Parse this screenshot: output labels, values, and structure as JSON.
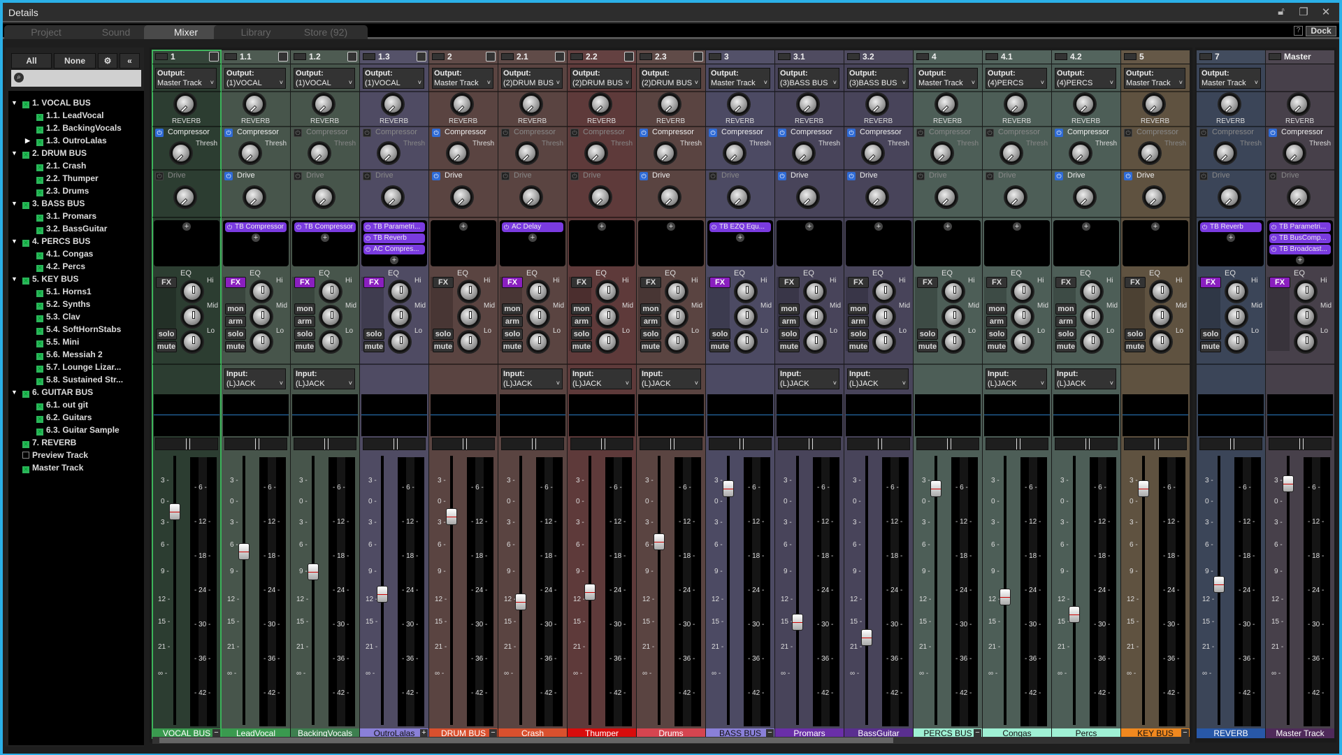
{
  "window": {
    "title": "Details"
  },
  "tabs": [
    {
      "label": "Project",
      "active": false
    },
    {
      "label": "Sound",
      "active": false
    },
    {
      "label": "Mixer",
      "active": true
    },
    {
      "label": "Library",
      "active": false
    },
    {
      "label": "Store (92)",
      "active": false
    }
  ],
  "toolbar": {
    "help_label": "?",
    "dock_label": "Dock"
  },
  "sidebar": {
    "all_label": "All",
    "none_label": "None",
    "search_placeholder": "",
    "tree": [
      {
        "label": "1. VOCAL BUS",
        "level": 0,
        "expanded": true,
        "checked": true
      },
      {
        "label": "1.1. LeadVocal",
        "level": 1,
        "checked": true
      },
      {
        "label": "1.2. BackingVocals",
        "level": 1,
        "checked": true
      },
      {
        "label": "1.3. OutroLalas",
        "level": 1,
        "checked": true,
        "collapsed": true
      },
      {
        "label": "2. DRUM BUS",
        "level": 0,
        "expanded": true,
        "checked": true
      },
      {
        "label": "2.1. Crash",
        "level": 1,
        "checked": true
      },
      {
        "label": "2.2. Thumper",
        "level": 1,
        "checked": true
      },
      {
        "label": "2.3. Drums",
        "level": 1,
        "checked": true
      },
      {
        "label": "3. BASS BUS",
        "level": 0,
        "expanded": true,
        "checked": true
      },
      {
        "label": "3.1. Promars",
        "level": 1,
        "checked": true
      },
      {
        "label": "3.2. BassGuitar",
        "level": 1,
        "checked": true
      },
      {
        "label": "4. PERCS BUS",
        "level": 0,
        "expanded": true,
        "checked": true
      },
      {
        "label": "4.1. Congas",
        "level": 1,
        "checked": true
      },
      {
        "label": "4.2. Percs",
        "level": 1,
        "checked": true
      },
      {
        "label": "5. KEY BUS",
        "level": 0,
        "expanded": true,
        "checked": true
      },
      {
        "label": "5.1. Horns1",
        "level": 1,
        "checked": true
      },
      {
        "label": "5.2. Synths",
        "level": 1,
        "checked": true
      },
      {
        "label": "5.3. Clav",
        "level": 1,
        "checked": true
      },
      {
        "label": "5.4. SoftHornStabs",
        "level": 1,
        "checked": true
      },
      {
        "label": "5.5. Mini",
        "level": 1,
        "checked": true
      },
      {
        "label": "5.6. Messiah 2",
        "level": 1,
        "checked": true
      },
      {
        "label": "5.7. Lounge Lizar...",
        "level": 1,
        "checked": true
      },
      {
        "label": "5.8. Sustained Str...",
        "level": 1,
        "checked": true
      },
      {
        "label": "6. GUITAR BUS",
        "level": 0,
        "expanded": true,
        "checked": true
      },
      {
        "label": "6.1. out git",
        "level": 1,
        "checked": true
      },
      {
        "label": "6.2. Guitars",
        "level": 1,
        "checked": true
      },
      {
        "label": "6.3. Guitar Sample",
        "level": 1,
        "checked": true
      },
      {
        "label": "7. REVERB",
        "level": 0,
        "checked": true
      },
      {
        "label": "Preview Track",
        "level": 0,
        "checked": false
      },
      {
        "label": "Master Track",
        "level": 0,
        "checked": true
      }
    ]
  },
  "labels": {
    "output": "Output:",
    "input": "Input:",
    "reverb": "REVERB",
    "compressor": "Compressor",
    "thresh": "Thresh",
    "drive": "Drive",
    "eq": "EQ",
    "hi": "Hi",
    "mid": "Mid",
    "lo": "Lo",
    "fx": "FX",
    "mon": "mon",
    "arm": "arm",
    "solo": "solo",
    "mute": "mute"
  },
  "fader_scale": [
    "3 -",
    "0 -",
    "3 -",
    "6 -",
    "9 -",
    "12 -",
    "15 -",
    "21 -",
    "∞ -"
  ],
  "meter_scale": [
    "- 6 -",
    "- 12 -",
    "- 18 -",
    "- 24 -",
    "- 30 -",
    "- 36 -",
    "- 42 -"
  ],
  "strips": [
    {
      "num": "1",
      "name": "VOCAL BUS",
      "output": "Master Track",
      "bg": "#2c3d31",
      "label_bg": "#3a9a4f",
      "label_fg": "#fff",
      "selected": true,
      "bus": true,
      "collapse": "−",
      "comp_on": true,
      "drive_on": false,
      "fx_on": false,
      "record": false,
      "input": null,
      "plugins": [],
      "fader_db": "+1.5"
    },
    {
      "num": "1.1",
      "name": "LeadVocal",
      "output": "(1)VOCAL",
      "bg": "#47554b",
      "label_bg": "#3a9a4f",
      "label_fg": "#fff",
      "comp_on": true,
      "drive_on": true,
      "fx_on": true,
      "record": true,
      "input": "(L)JACK",
      "plugins": [
        "TB Compressor"
      ],
      "fader_db": "-6"
    },
    {
      "num": "1.2",
      "name": "BackingVocals",
      "output": "(1)VOCAL",
      "bg": "#47554b",
      "label_bg": "#3d7f4f",
      "label_fg": "#fff",
      "comp_on": false,
      "drive_on": false,
      "fx_on": true,
      "record": true,
      "input": "(L)JACK",
      "plugins": [
        "TB Compressor"
      ],
      "fader_db": "-8.5"
    },
    {
      "num": "1.3",
      "name": "OutroLalas",
      "output": "(1)VOCAL",
      "bg": "#4f4b63",
      "label_bg": "#8a80d8",
      "label_fg": "#111",
      "bus": true,
      "collapse": "+",
      "comp_on": false,
      "drive_on": false,
      "fx_on": true,
      "record": false,
      "input": null,
      "plugins": [
        "TB Parametri...",
        "TB Reverb",
        "AC Compres..."
      ],
      "fader_db": "-9.5"
    },
    {
      "num": "2",
      "name": "DRUM BUS",
      "output": "Master Track",
      "bg": "#5a4441",
      "label_bg": "#d9502e",
      "label_fg": "#fff",
      "bus": true,
      "collapse": "−",
      "comp_on": true,
      "drive_on": true,
      "fx_on": false,
      "record": false,
      "input": null,
      "plugins": [],
      "fader_db": "-1.5"
    },
    {
      "num": "2.1",
      "name": "Crash",
      "output": "(2)DRUM BUS",
      "bg": "#5a4441",
      "label_bg": "#d9502e",
      "label_fg": "#fff",
      "comp_on": false,
      "drive_on": false,
      "fx_on": true,
      "record": true,
      "input": "(L)JACK",
      "plugins": [
        "AC Delay"
      ],
      "fader_db": "-11"
    },
    {
      "num": "2.2",
      "name": "Thumper",
      "output": "(2)DRUM BUS",
      "bg": "#5e3a3a",
      "label_bg": "#d80c0c",
      "label_fg": "#fff",
      "comp_on": false,
      "drive_on": false,
      "fx_on": false,
      "record": true,
      "input": "(L)JACK",
      "plugins": [],
      "fader_db": "-9.5"
    },
    {
      "num": "2.3",
      "name": "Drums",
      "output": "(2)DRUM BUS",
      "bg": "#5a4441",
      "label_bg": "#d54550",
      "label_fg": "#fff",
      "comp_on": true,
      "drive_on": true,
      "fx_on": false,
      "record": true,
      "input": "(L)JACK",
      "plugins": [],
      "fader_db": "-5"
    },
    {
      "num": "3",
      "name": "BASS BUS",
      "output": "Master Track",
      "bg": "#4c4a63",
      "label_bg": "#8a80d8",
      "label_fg": "#111",
      "bus": true,
      "collapse": "−",
      "comp_on": true,
      "drive_on": false,
      "fx_on": true,
      "record": false,
      "input": null,
      "plugins": [
        "TB EZQ Equ..."
      ],
      "fader_db": "+1.5"
    },
    {
      "num": "3.1",
      "name": "Promars",
      "output": "(3)BASS BUS",
      "bg": "#48445a",
      "label_bg": "#6a2fa8",
      "label_fg": "#fff",
      "comp_on": true,
      "drive_on": true,
      "fx_on": false,
      "record": true,
      "input": "(L)JACK",
      "plugins": [],
      "fader_db": "-12"
    },
    {
      "num": "3.2",
      "name": "BassGuitar",
      "output": "(3)BASS BUS",
      "bg": "#48445a",
      "label_bg": "#5a2f90",
      "label_fg": "#fff",
      "comp_on": true,
      "drive_on": true,
      "fx_on": false,
      "record": true,
      "input": "(L)JACK",
      "plugins": [],
      "fader_db": "-15"
    },
    {
      "num": "4",
      "name": "PERCS BUS",
      "output": "Master Track",
      "bg": "#4d5e57",
      "label_bg": "#9ff0d4",
      "label_fg": "#111",
      "bus": true,
      "collapse": "−",
      "comp_on": false,
      "drive_on": false,
      "fx_on": false,
      "record": false,
      "input": null,
      "plugins": [],
      "fader_db": "+1.5"
    },
    {
      "num": "4.1",
      "name": "Congas",
      "output": "(4)PERCS",
      "bg": "#4d5e57",
      "label_bg": "#9ff0d4",
      "label_fg": "#111",
      "comp_on": false,
      "drive_on": false,
      "fx_on": false,
      "record": true,
      "input": "(L)JACK",
      "plugins": [],
      "fader_db": "-10.5"
    },
    {
      "num": "4.2",
      "name": "Percs",
      "output": "(4)PERCS",
      "bg": "#4d5e57",
      "label_bg": "#9ff0d4",
      "label_fg": "#111",
      "comp_on": true,
      "drive_on": true,
      "fx_on": false,
      "record": true,
      "input": "(L)JACK",
      "plugins": [],
      "fader_db": "-12.5"
    },
    {
      "num": "5",
      "name": "KEY BUS",
      "output": "Master Track",
      "bg": "#5f5240",
      "label_bg": "#f0881f",
      "label_fg": "#111",
      "bus": true,
      "collapse": "−",
      "comp_on": false,
      "drive_on": true,
      "fx_on": false,
      "record": false,
      "input": null,
      "plugins": [],
      "fader_db": "+1.5"
    }
  ],
  "right_strips": [
    {
      "num": "7",
      "name": "REVERB",
      "output": "Master Track",
      "bg": "#3b4558",
      "label_bg": "#2858a8",
      "label_fg": "#fff",
      "comp_on": false,
      "drive_on": false,
      "fx_on": true,
      "record": false,
      "input": null,
      "plugins": [
        "TB Reverb"
      ],
      "fader_db": "-8"
    },
    {
      "num": "Master",
      "name": "Master Track",
      "output": null,
      "bg": "#47404a",
      "label_bg": "#4f2a5a",
      "label_fg": "#fff",
      "comp_on": true,
      "drive_on": false,
      "fx_on": true,
      "record": false,
      "master": true,
      "input": null,
      "plugins": [
        "TB Parametri...",
        "TB BusComp...",
        "TB Broadcast..."
      ],
      "fader_db": "0"
    }
  ],
  "fader_positions": [
    0.16,
    0.32,
    0.4,
    0.49,
    0.18,
    0.52,
    0.48,
    0.28,
    0.07,
    0.6,
    0.66,
    0.07,
    0.5,
    0.57,
    0.07,
    0.45,
    0.05
  ]
}
